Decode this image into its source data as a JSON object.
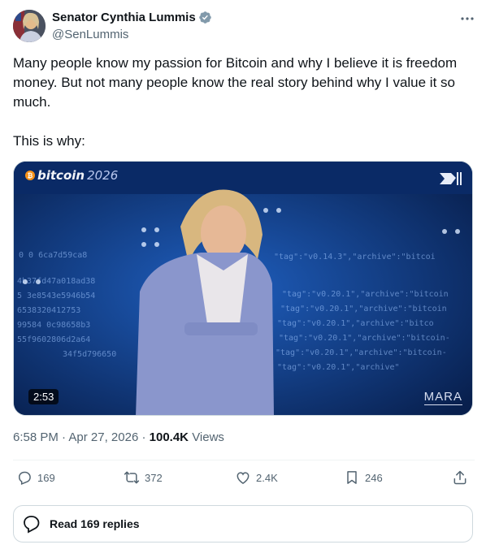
{
  "author": {
    "display_name": "Senator Cynthia Lummis",
    "handle": "@SenLummis"
  },
  "tweet": {
    "paragraph1": "Many people know my passion for Bitcoin and why I believe it is freedom money. But not many people know the real story behind why I value it so much.",
    "paragraph2": "This is why:"
  },
  "video": {
    "event_brand": "bitcoin",
    "event_year": "2026",
    "duration": "2:53",
    "sponsor": "MARA"
  },
  "meta": {
    "time": "6:58 PM",
    "separator": "·",
    "date": "Apr 27, 2026",
    "views_count": "100.4K",
    "views_label": "Views"
  },
  "actions": {
    "replies": "169",
    "reposts": "372",
    "likes": "2.4K",
    "bookmarks": "246"
  },
  "read_replies_label": "Read 169 replies",
  "colors": {
    "verified": "#829aab",
    "text_primary": "#0f1419",
    "text_secondary": "#536471",
    "border": "#cfd9de",
    "video_bg": "#0c2f6e"
  },
  "icons": [
    "verified-badge-icon",
    "more-icon",
    "reply-icon",
    "repost-icon",
    "like-icon",
    "bookmark-icon",
    "share-icon",
    "replies-bubble-icon"
  ]
}
